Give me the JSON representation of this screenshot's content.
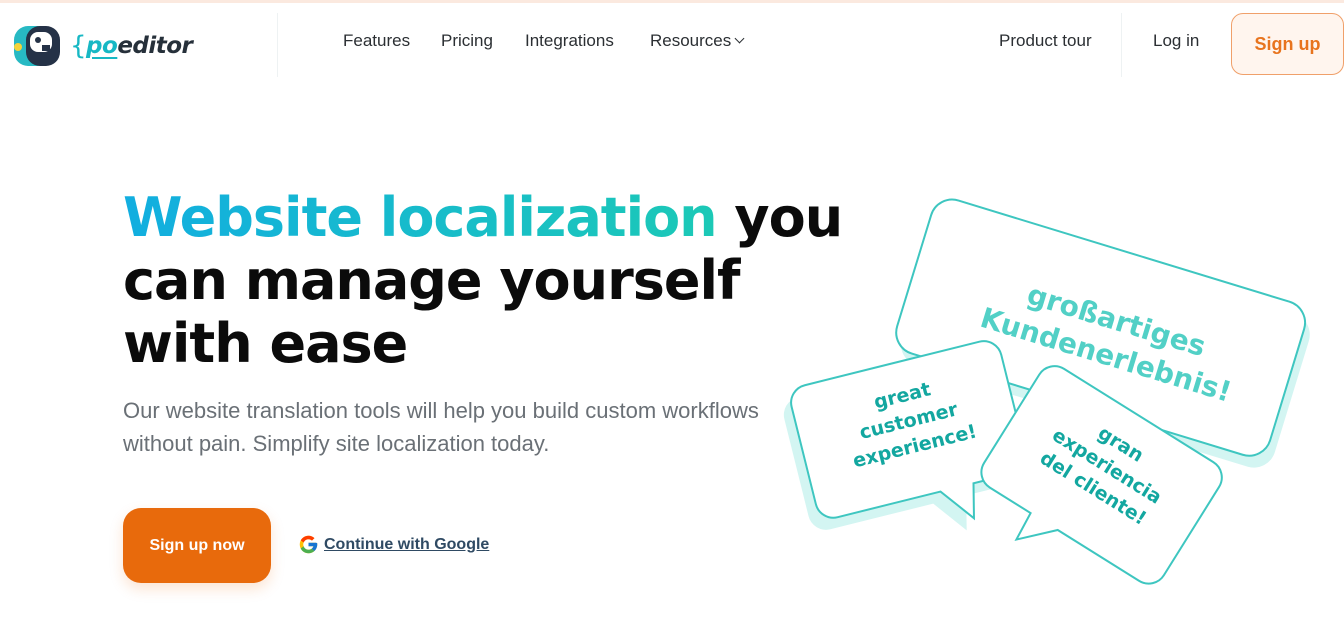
{
  "header": {
    "logo_prefix": "po",
    "logo_suffix": "editor",
    "nav": {
      "features": "Features",
      "pricing": "Pricing",
      "integrations": "Integrations",
      "resources": "Resources"
    },
    "product_tour": "Product tour",
    "login": "Log in",
    "signup": "Sign up"
  },
  "hero": {
    "title_accent": "Website localization",
    "title_rest": " you can manage yourself with ease",
    "subtitle": "Our website translation tools will help you build custom workflows without pain. Simplify site localization today.",
    "cta": "Sign up now",
    "google": "Continue with Google"
  },
  "illustration": {
    "bubble_de_line1": "großartiges",
    "bubble_de_line2": "Kundenerlebnis!",
    "bubble_en_line1": "great",
    "bubble_en_line2": "customer",
    "bubble_en_line3": "experience!",
    "bubble_es_line1": "gran",
    "bubble_es_line2": "experiencia",
    "bubble_es_line3": "del cliente!"
  },
  "colors": {
    "accent_teal": "#1cc9b6",
    "accent_blue": "#12aee0",
    "cta_orange": "#e86a0c",
    "signup_orange": "#e8741e"
  }
}
